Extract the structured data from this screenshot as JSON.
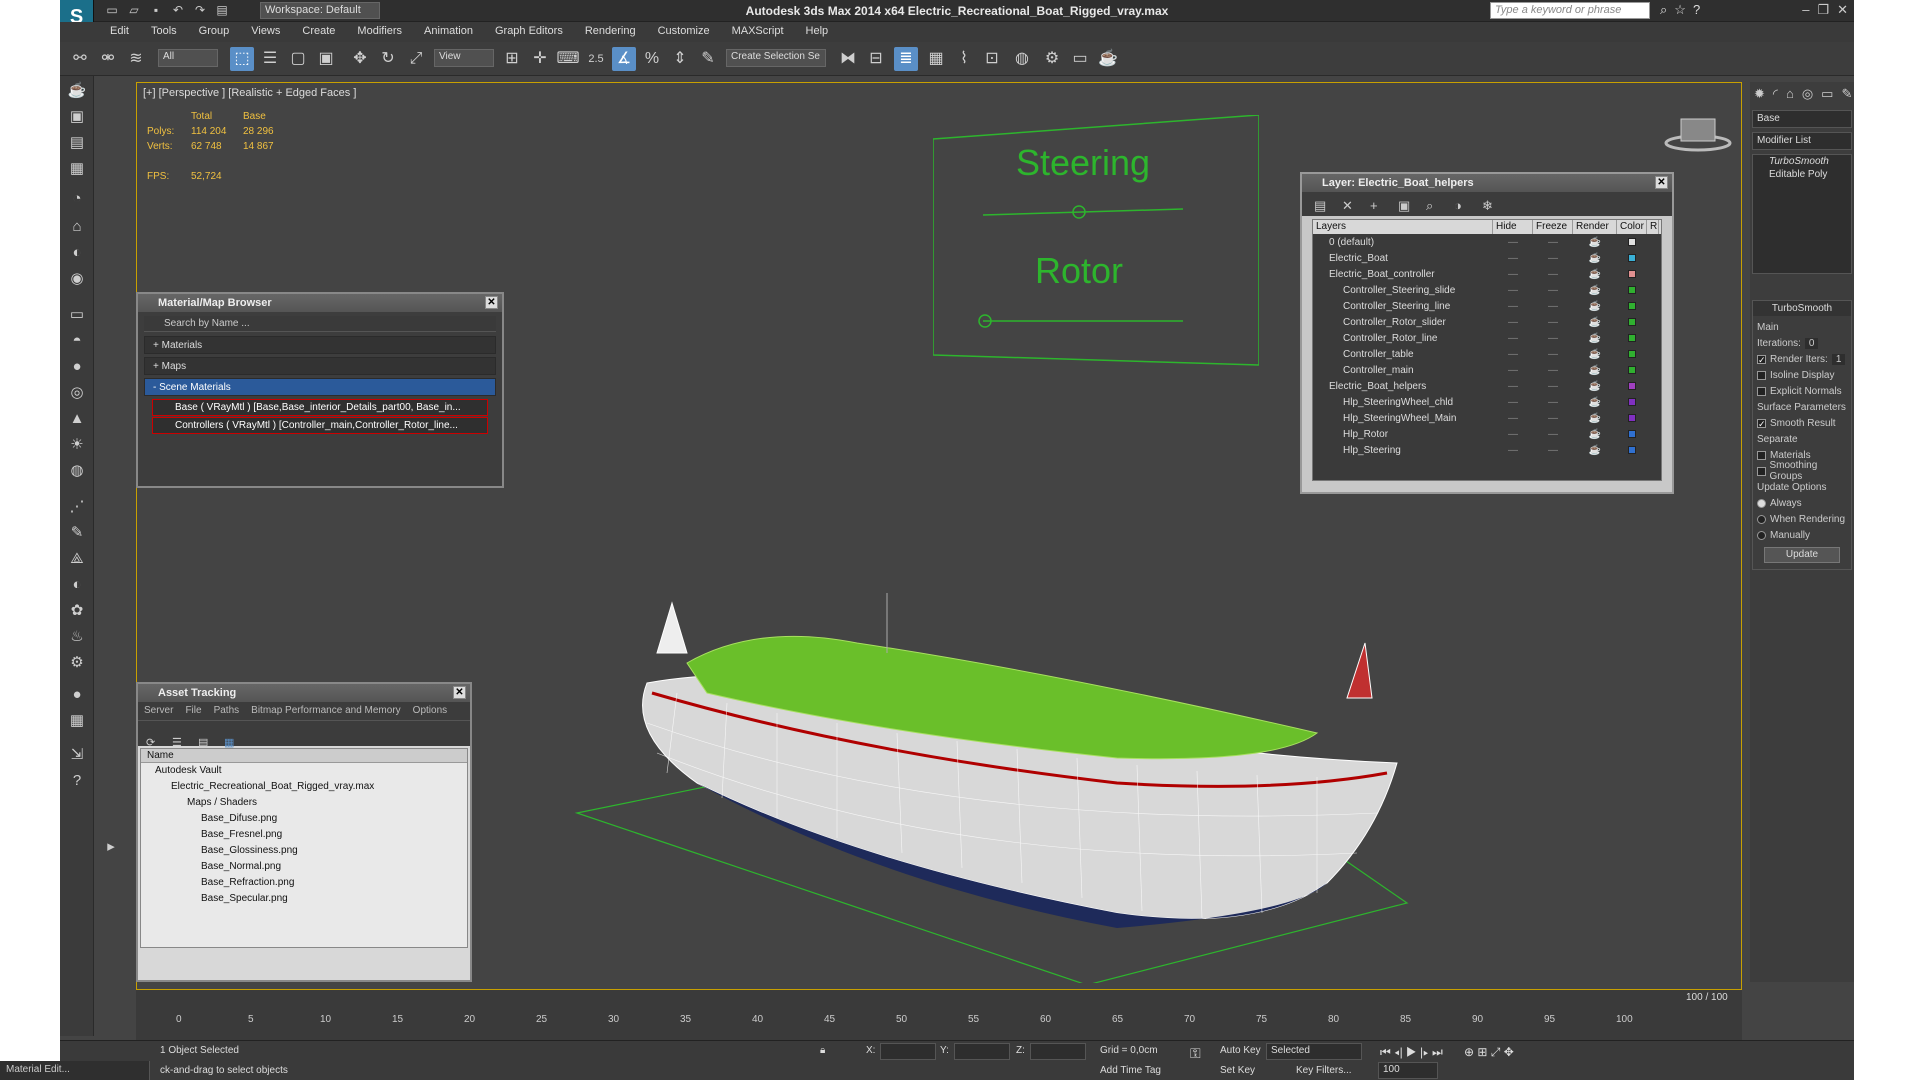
{
  "window": {
    "title": "Autodesk 3ds Max  2014 x64     Electric_Recreational_Boat_Rigged_vray.max",
    "workspace": "Workspace: Default",
    "search_placeholder": "Type a keyword or phrase"
  },
  "menu": [
    "Edit",
    "Tools",
    "Group",
    "Views",
    "Create",
    "Modifiers",
    "Animation",
    "Graph Editors",
    "Rendering",
    "Customize",
    "MAXScript",
    "Help"
  ],
  "toolbar": {
    "filter": "All",
    "ref_coord": "View",
    "selection_set": "Create Selection Se",
    "snap_angle": "2.5"
  },
  "viewport": {
    "label": "[+] [Perspective ] [Realistic + Edged Faces ]",
    "stats": {
      "header_total": "Total",
      "header_base": "Base",
      "polys_label": "Polys:",
      "polys_total": "114 204",
      "polys_base": "28 296",
      "verts_label": "Verts:",
      "verts_total": "62 748",
      "verts_base": "14 867",
      "fps_label": "FPS:",
      "fps_value": "52,724"
    },
    "controller_labels": {
      "steering": "Steering",
      "rotor": "Rotor"
    }
  },
  "material_browser": {
    "title": "Material/Map Browser",
    "search": "Search by Name ...",
    "sections": [
      "+ Materials",
      "+ Maps",
      "- Scene Materials"
    ],
    "items": [
      "Base ( VRayMtl ) [Base,Base_interior_Details_part00, Base_in...",
      "Controllers ( VRayMtl ) [Controller_main,Controller_Rotor_line..."
    ]
  },
  "asset_tracking": {
    "title": "Asset Tracking",
    "menu": [
      "Server",
      "File",
      "Paths",
      "Bitmap Performance and Memory",
      "Options"
    ],
    "column": "Name",
    "rows": [
      "Autodesk Vault",
      "Electric_Recreational_Boat_Rigged_vray.max",
      "Maps / Shaders",
      "Base_Difuse.png",
      "Base_Fresnel.png",
      "Base_Glossiness.png",
      "Base_Normal.png",
      "Base_Refraction.png",
      "Base_Specular.png"
    ]
  },
  "layer_panel": {
    "title": "Layer: Electric_Boat_helpers",
    "columns": [
      "Layers",
      "Hide",
      "Freeze",
      "Render",
      "Color",
      "R"
    ],
    "rows": [
      {
        "name": "0 (default)",
        "color": "#e0e0e0"
      },
      {
        "name": "Electric_Boat",
        "color": "#3ab0d6"
      },
      {
        "name": "Electric_Boat_controller",
        "color": "#e09090"
      },
      {
        "name": "Controller_Steering_slide",
        "color": "#30b030"
      },
      {
        "name": "Controller_Steering_line",
        "color": "#30b030"
      },
      {
        "name": "Controller_Rotor_slider",
        "color": "#30b030"
      },
      {
        "name": "Controller_Rotor_line",
        "color": "#30b030"
      },
      {
        "name": "Controller_table",
        "color": "#30b030"
      },
      {
        "name": "Controller_main",
        "color": "#30b030"
      },
      {
        "name": "Electric_Boat_helpers",
        "color": "#a040c0"
      },
      {
        "name": "Hlp_SteeringWheel_chld",
        "color": "#8030c0"
      },
      {
        "name": "Hlp_SteeringWheel_Main",
        "color": "#8030c0"
      },
      {
        "name": "Hlp_Rotor",
        "color": "#3070d0"
      },
      {
        "name": "Hlp_Steering",
        "color": "#3070d0"
      }
    ]
  },
  "command_panel": {
    "object_name": "Base",
    "modifier_list": "Modifier List",
    "stack": [
      "TurboSmooth",
      "Editable Poly"
    ],
    "turbosmooth": {
      "header": "TurboSmooth",
      "main": "Main",
      "iterations_label": "Iterations:",
      "iterations_value": "0",
      "render_iters_label": "Render Iters:",
      "render_iters_value": "1",
      "isoline": "Isoline Display",
      "explicit_normals": "Explicit Normals",
      "surface_params": "Surface Parameters",
      "smooth_result": "Smooth Result",
      "separate": "Separate",
      "materials": "Materials",
      "smoothing_groups": "Smoothing Groups",
      "update_options": "Update Options",
      "always": "Always",
      "when_rendering": "When Rendering",
      "manually": "Manually",
      "update_btn": "Update"
    }
  },
  "timeline": {
    "frame": "100 / 100",
    "ticks": [
      "0",
      "5",
      "10",
      "15",
      "20",
      "25",
      "30",
      "35",
      "40",
      "45",
      "50",
      "55",
      "60",
      "65",
      "70",
      "75",
      "80",
      "85",
      "90",
      "95",
      "100"
    ]
  },
  "status": {
    "selected": "1 Object Selected",
    "hint": "ck-and-drag to select objects",
    "grid": "Grid = 0,0cm",
    "auto_key": "Auto Key",
    "set_key": "Set Key",
    "selected_mode": "Selected",
    "key_filters": "Key Filters...",
    "add_time_tag": "Add Time Tag",
    "frame_value": "100",
    "x_label": "X:",
    "y_label": "Y:",
    "z_label": "Z:",
    "material_tab": "Material Edit..."
  }
}
